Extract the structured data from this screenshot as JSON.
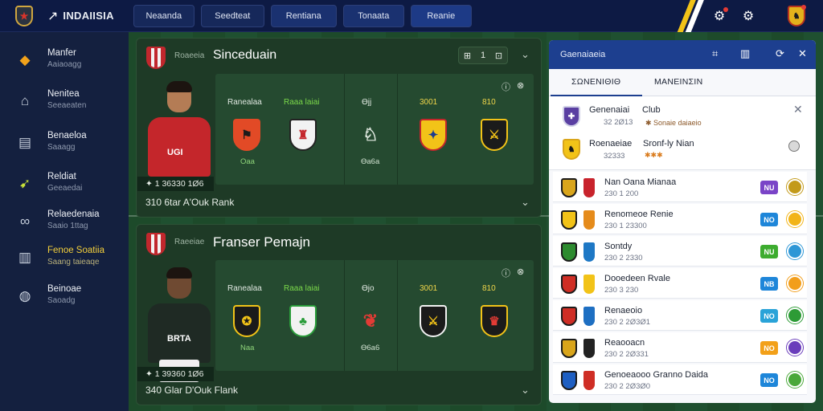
{
  "topbar": {
    "app_title": "INDAIISIA",
    "tabs": [
      "Neaanda",
      "Seedteat",
      "Rentiana",
      "Tonaata",
      "Reanie"
    ],
    "stripe_colors": [
      "#f2c318",
      "#0d1a44",
      "#f2c318",
      "#ffffff"
    ]
  },
  "sidebar": {
    "items": [
      {
        "label": "Manfer",
        "sub": "Aaiaoagg",
        "icon": "shield-icon"
      },
      {
        "label": "Nenitea",
        "sub": "Seeaeaten",
        "icon": "house-icon"
      },
      {
        "label": "Benaeloa",
        "sub": "Saaagg",
        "icon": "clipboard-icon"
      },
      {
        "label": "Reldiat",
        "sub": "Geeaedai",
        "icon": "boot-icon"
      },
      {
        "label": "Relaedenaia",
        "sub": "Saaio 1ttag",
        "icon": "infinity-icon"
      },
      {
        "label": "Fenoe Soatiia",
        "sub": "Saang taieaqe",
        "icon": "stats-icon",
        "active": true
      },
      {
        "label": "Beinoae",
        "sub": "Saoadg",
        "icon": "globe-icon"
      }
    ]
  },
  "cards": [
    {
      "sub": "Roaeeia",
      "title": "Sinceduain",
      "controls": [
        "⊞",
        "1",
        "⊡"
      ],
      "rating": "✦ 1 36330 1Ø6",
      "footer": "310 6tar A'Ouk Rank",
      "columns": [
        {
          "label": "Ranealaa",
          "color": "white"
        },
        {
          "label": "Raaa laiai",
          "color": "green"
        },
        {
          "label": "Ɵjj",
          "color": "white"
        },
        {
          "label": "3001",
          "color": "yellow"
        },
        {
          "label": "810",
          "color": "yellow"
        }
      ],
      "crest_caption": "Oaa",
      "crest_caption2": "Ɵa6a",
      "shirt_text": "UGI",
      "shirt_color": "#c4262b"
    },
    {
      "sub": "Raeeiae",
      "title": "Franser Pemajn",
      "controls": [],
      "rating": "✦ 1 39360 1Ø6",
      "footer": "340 Glar D'Ouk Flank",
      "columns": [
        {
          "label": "Ranealaa",
          "color": "white"
        },
        {
          "label": "Raaa laiai",
          "color": "green"
        },
        {
          "label": "Ɵjo",
          "color": "white"
        },
        {
          "label": "3001",
          "color": "yellow"
        },
        {
          "label": "810",
          "color": "yellow"
        }
      ],
      "crest_caption": "Naa",
      "crest_caption2": "Ɵ6a6",
      "shirt_text": "BRTA",
      "shirt_color": "#1f2a24"
    }
  ],
  "rpanel": {
    "title": "Gaenaiaeia",
    "tabs": [
      "ΣΩΝΕΝΙΘΙΘ",
      "ΜΑΝΕΙΝΣΙΝ"
    ],
    "feature": [
      {
        "name": "Genenaiai",
        "sub": "32 2Ø13",
        "tag": "Club",
        "orange": "✱ Sonaie daiaeio"
      },
      {
        "name": "Roenaeiae",
        "sub": "32333",
        "tag": "Sronf-ly Nian",
        "orange": "✱✱✱"
      }
    ],
    "rows": [
      {
        "name": "Nan Oana Mianaa",
        "meta": "230    1 200",
        "pill": "NU",
        "pill_color": "#7a44c7",
        "round": "#c39a1a",
        "c1": "#d9a51b",
        "c2": "#c8232c"
      },
      {
        "name": "Renomeoe Renie",
        "meta": "230    1 23300",
        "pill": "NO",
        "pill_color": "#1e86d9",
        "round": "#f2b417",
        "c1": "#f2c318",
        "c2": "#e58b1b"
      },
      {
        "name": "Sontdy",
        "meta": "230    2 2330",
        "pill": "NU",
        "pill_color": "#3dac2f",
        "round": "#2e97d6",
        "c1": "#2d8b2f",
        "c2": "#1e78c5"
      },
      {
        "name": "Dooedeen Rvale",
        "meta": "230    3 230",
        "pill": "NB",
        "pill_color": "#1e86d9",
        "round": "#f29e1b",
        "c1": "#cf2e25",
        "c2": "#f2c318"
      },
      {
        "name": "Renaeoio",
        "meta": "230    2 2Ø3Ø1",
        "pill": "NO",
        "pill_color": "#2aa3d8",
        "round": "#2d9b36",
        "c1": "#cf2e25",
        "c2": "#1e6fc2"
      },
      {
        "name": "Reaooacn",
        "meta": "230    2 2Ø331",
        "pill": "NO",
        "pill_color": "#f2a019",
        "round": "#6a3dbb",
        "c1": "#d9a51b",
        "c2": "#222222"
      },
      {
        "name": "Genoeaooo Granno Daida",
        "meta": "230    2 2Ø3Ø0",
        "pill": "NO",
        "pill_color": "#1e86d9",
        "round": "#4aa83a",
        "c1": "#1e5fc2",
        "c2": "#cf2e25"
      }
    ]
  }
}
